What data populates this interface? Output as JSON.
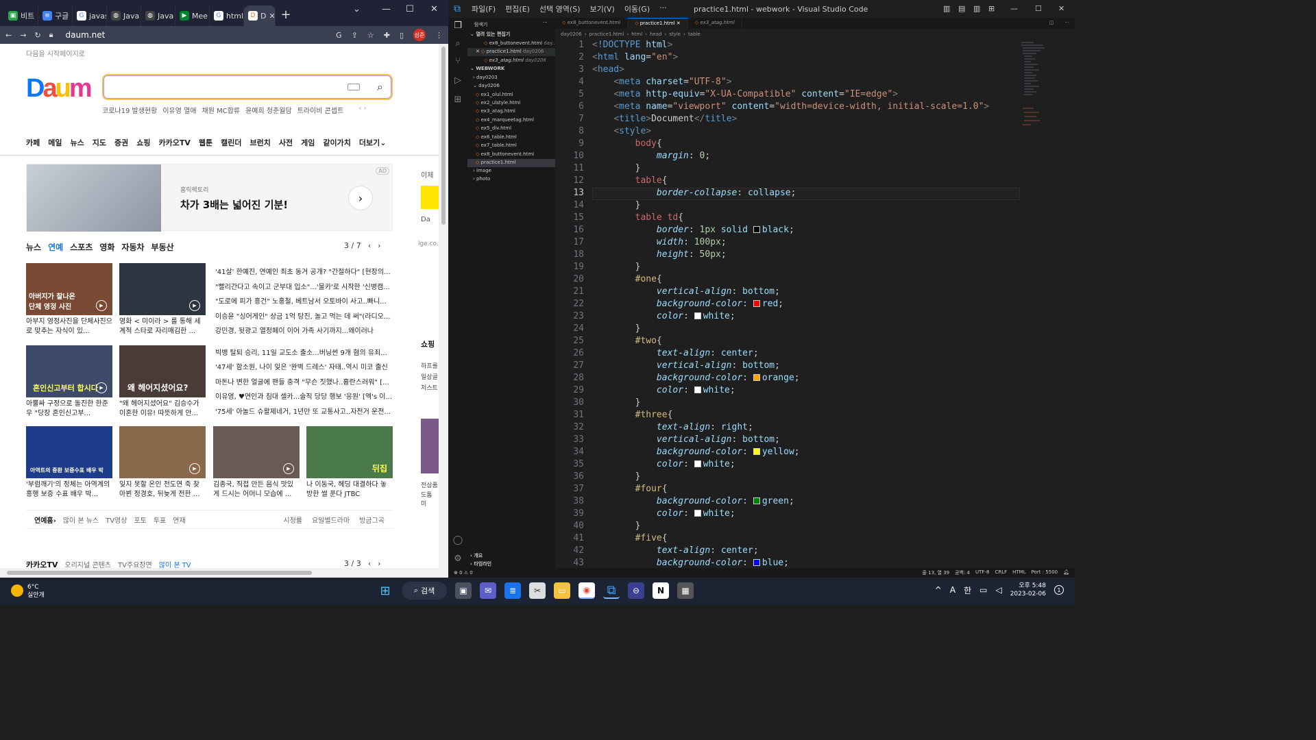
{
  "browser": {
    "tabs": [
      "비트",
      "구글",
      "javas",
      "Java",
      "Java",
      "Mee",
      "html",
      "D"
    ],
    "url": "daum.net",
    "profile": "성준",
    "start_page_link": "다음을 시작페이지로",
    "logo": "Daum",
    "trends": [
      "코로나19 발생현황",
      "이유영 열애",
      "채원 MC합류",
      "윤예희 청춘월담",
      "트라이비 콘셉트"
    ],
    "nav": [
      "카페",
      "메일",
      "뉴스",
      "지도",
      "증권",
      "쇼핑",
      "카카오TV",
      "웹툰",
      "캘린더",
      "브런치",
      "사전",
      "게임",
      "같이가치",
      "더보기"
    ],
    "ad": {
      "sub": "홈릭렉토리",
      "title": "차가 3배는 넓어진 기분!",
      "badge": "AD"
    },
    "news_tabs": [
      "뉴스",
      "연예",
      "스포츠",
      "영화",
      "자동차",
      "부동산"
    ],
    "news_pager": "3 / 7",
    "thumbs": [
      {
        "overlay": "아버지가 찰나온 단체 영정 사진",
        "caption": "아부지 영정사진을 단체사진으로 맞추는 자식이 있..."
      },
      {
        "overlay": "",
        "caption": "영화 < 미이라 > 를 통해 세계적 스타로 자리매김한 ..."
      },
      {
        "overlay": "혼인신고부터 합시다",
        "caption": "아뿔싸 구정으로 돌진한 한준우 \"당장 혼인신고부..."
      },
      {
        "overlay": "왜 헤어지셨어요?",
        "caption": "\"왜 헤어지셨어요\" 김승수가 이혼한 이유! 따뜻하게 안..."
      },
      {
        "overlay": "아역트의 중환 보증수표 배우 박",
        "caption": "'부럼깨기'의 정체는 아역계의 흥행 보증 수표 배우 박..."
      },
      {
        "overlay": "",
        "caption": "잊지 못할 온인 전도연 죽 찾아뵌 정경호, 뒤늦게 전한 ..."
      },
      {
        "overlay": "",
        "caption": "김종국, 직접 만든 음식 맛있게 드시는 어머니 모습에 ..."
      },
      {
        "overlay": "뒤집",
        "caption": "나 이동국, 헤딩 대결하다 놓방한 썰 푼다 JTBC 230205..."
      }
    ],
    "headlines": [
      "'41살' 한예진, 연예인 최초 동거 공개? \"간절하다\" [현장의...",
      "\"빨리간다고 속이고 군부대 입소\"...'물카'로 시작한 '신병캠...",
      "\"도로에 피가 흥건\" 노홍철, 베트남서 오토바이 사고..빠니...",
      "이승윤 \"싱어게인\" 상금 1억 탕진, 놀고 먹는 데 써\"(라디오...",
      "강민경, 뒷광고 열정페이 이어 가족 사기까지...왜이러나",
      "빅뱅 탈퇴 승리, 11일 교도소 출소...버닝썬 9개 혐의 유죄...",
      "'47세' 함소원, 나이 잊은 '완벽 드레스' 자태..역시 미코 출신",
      "마돈나 변한 얼굴에 팬들 충격 \"무슨 짓했나..흉란스러워\" [...",
      "이유영, ♥연인과 침대 셀카...술직 당당 행보 '응원' [엑's 이...",
      "'75세' 아놀드 슈왈제네거, 1년만 또 교통사고..자전거 운전..."
    ],
    "bottom_links": [
      "연예홈",
      "많이 본 뉴스",
      "TV영상",
      "포토",
      "투표",
      "연재"
    ],
    "bottom_links_right": [
      "시청률",
      "요일별드라마",
      "방금그곡"
    ],
    "kakaotv": {
      "title": "카카오TV",
      "links": [
        "오리지널 콘텐츠",
        "TV주요장면",
        "많이 본 TV"
      ],
      "pager": "3 / 3"
    },
    "right_col": [
      "이제",
      "Da",
      "lge.co.",
      "쇼핑",
      "하프를",
      "일상골",
      "저스트",
      "전상품",
      "도톰 미"
    ]
  },
  "vscode": {
    "menu": [
      "파일(F)",
      "편집(E)",
      "선택 영역(S)",
      "보기(V)",
      "이동(G)",
      "···"
    ],
    "window_title": "practice1.html - webwork - Visual Studio Code",
    "sidebar": {
      "header": "탐색기",
      "open_editors_label": "열려 있는 편집기",
      "open_editors": [
        {
          "name": "ex8_buttonevent.html",
          "dir": "day..."
        },
        {
          "name": "practice1.html",
          "dir": "day0206"
        },
        {
          "name": "ex3_atag.html",
          "dir": "day0206"
        }
      ],
      "workspace": "WEBWORK",
      "tree": [
        "day0203",
        "day0206",
        "ex1_olul.html",
        "ex2_ulstyle.html",
        "ex3_atag.html",
        "ex4_marqueetag.html",
        "ex5_div.html",
        "ex6_table.html",
        "ex7_table.html",
        "ex8_buttonevent.html",
        "practice1.html",
        "image",
        "photo"
      ],
      "outline": "개요",
      "timeline": "타임라인"
    },
    "tabs": [
      "ex8_buttonevent.html",
      "practice1.html",
      "ex3_atag.html"
    ],
    "breadcrumbs": [
      "day0206",
      "practice1.html",
      "html",
      "head",
      "style",
      "table"
    ],
    "current_line": 13,
    "status": {
      "problems": "⊗ 0 ⚠ 0",
      "position": "줄 13, 열 39",
      "spaces": "공백: 4",
      "encoding": "UTF-8",
      "eol": "CRLF",
      "language": "HTML",
      "port": "Port : 5500"
    },
    "colors": {
      "red": "#ff0000",
      "orange": "#ffa500",
      "yellow": "#ffff00",
      "green": "#008000",
      "blue": "#0000ff",
      "white": "#ffffff",
      "black": "#000000"
    }
  },
  "taskbar": {
    "temp": "6°C",
    "weather": "실안개",
    "search": "검색",
    "ime": "한",
    "lang": "A",
    "time": "오후 5:48",
    "date": "2023-02-06"
  }
}
